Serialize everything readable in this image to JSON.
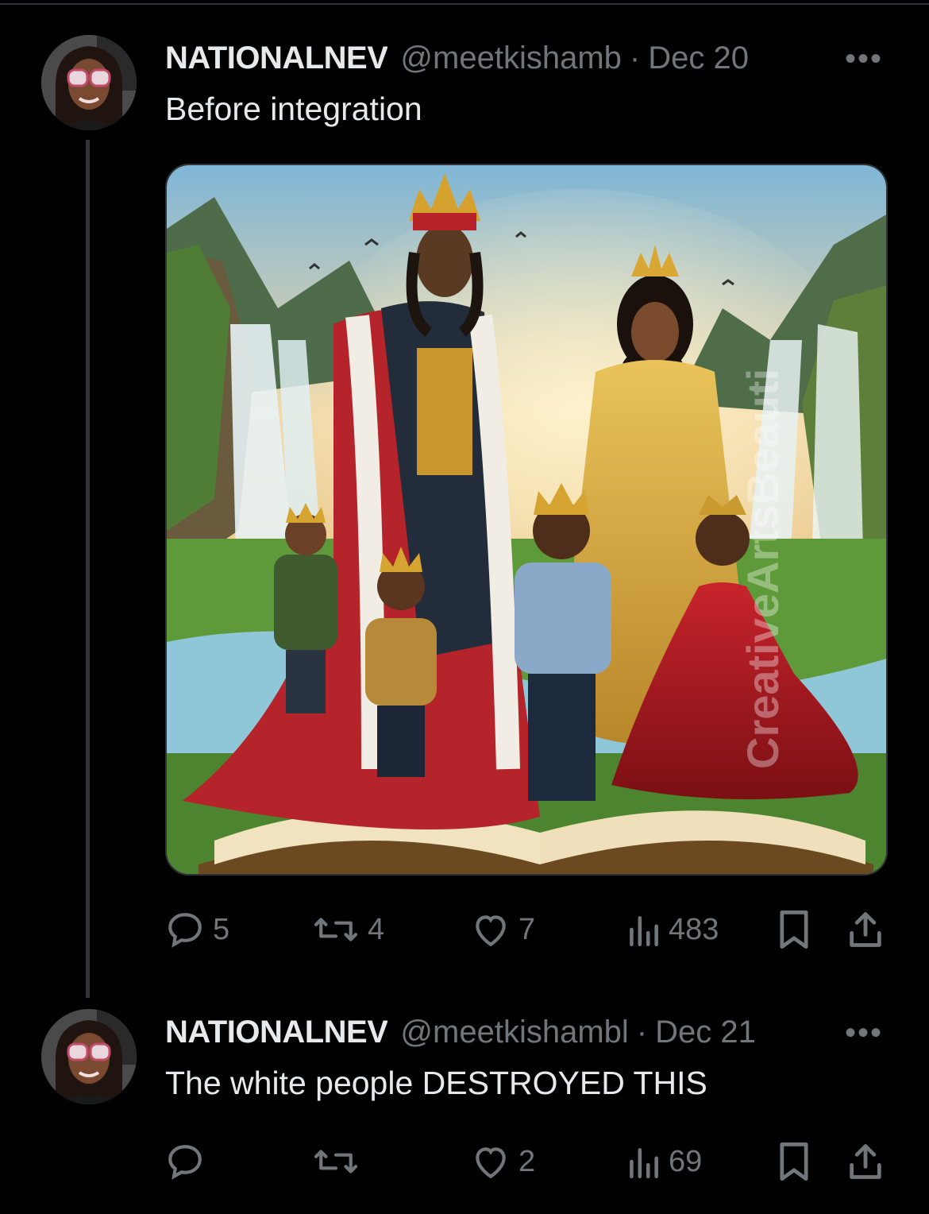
{
  "tweets": [
    {
      "display_name": "NATIONALNEV",
      "handle": "@meetkishamb",
      "separator": "·",
      "date": "Dec 20",
      "more": "•••",
      "text": "Before integration",
      "media": {
        "watermark": "CreativeArtsBeauti",
        "icon": "royal-family-illustration"
      },
      "actions": {
        "replies": "5",
        "reposts": "4",
        "likes": "7",
        "views": "483"
      }
    },
    {
      "display_name": "NATIONALNEV",
      "handle": "@meetkishambl",
      "separator": "·",
      "date": "Dec 21",
      "more": "•••",
      "text": "The white people DESTROYED THIS",
      "actions": {
        "replies": "",
        "reposts": "",
        "likes": "2",
        "views": "69"
      }
    }
  ],
  "colors": {
    "background": "#000000",
    "text_primary": "#e7e9ea",
    "text_secondary": "#71767b",
    "thread_line": "#333639"
  }
}
